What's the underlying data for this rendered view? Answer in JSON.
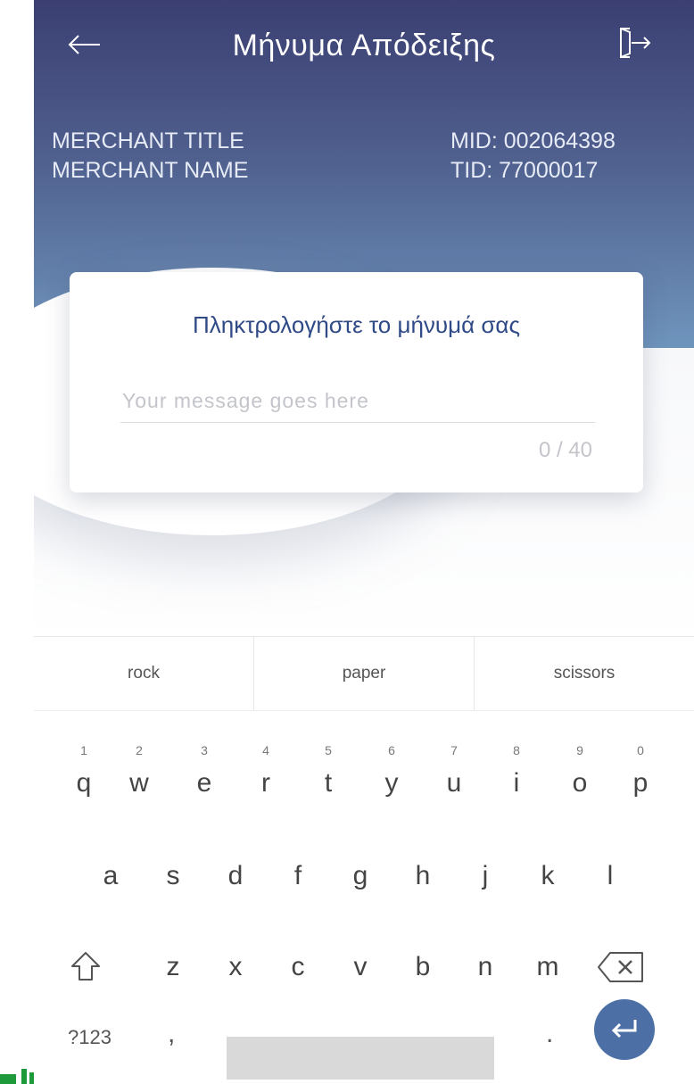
{
  "header": {
    "title": "Μήνυμα Απόδειξης",
    "back_icon": "arrow-left-icon",
    "exit_icon": "exit-door-icon",
    "merchant_title": "MERCHANT TITLE",
    "merchant_name": "MERCHANT NAME",
    "mid": "MID: 002064398",
    "tid": "TID: 77000017"
  },
  "card": {
    "title": "Πληκτρολογήστε το μήνυμά σας",
    "input_placeholder": "Your message goes here",
    "input_value": "",
    "counter": "0 / 40"
  },
  "keyboard": {
    "suggestions": [
      "rock",
      "paper",
      "scissors"
    ],
    "row1": [
      {
        "hint": "1",
        "ch": "q"
      },
      {
        "hint": "2",
        "ch": "w"
      },
      {
        "hint": "3",
        "ch": "e"
      },
      {
        "hint": "4",
        "ch": "r"
      },
      {
        "hint": "5",
        "ch": "t"
      },
      {
        "hint": "6",
        "ch": "y"
      },
      {
        "hint": "7",
        "ch": "u"
      },
      {
        "hint": "8",
        "ch": "i"
      },
      {
        "hint": "9",
        "ch": "o"
      },
      {
        "hint": "0",
        "ch": "p"
      }
    ],
    "row2": [
      "a",
      "s",
      "d",
      "f",
      "g",
      "h",
      "j",
      "k",
      "l"
    ],
    "row3": [
      "z",
      "x",
      "c",
      "v",
      "b",
      "n",
      "m"
    ],
    "symbols_label": "?123",
    "comma": ",",
    "period": ".",
    "shift_icon": "shift-icon",
    "backspace_icon": "backspace-icon",
    "enter_icon": "enter-icon"
  },
  "colors": {
    "header_top": "#3b3f72",
    "header_bottom": "#6f95bd",
    "accent": "#2f4a86",
    "enter_key": "#4c6fa6"
  }
}
